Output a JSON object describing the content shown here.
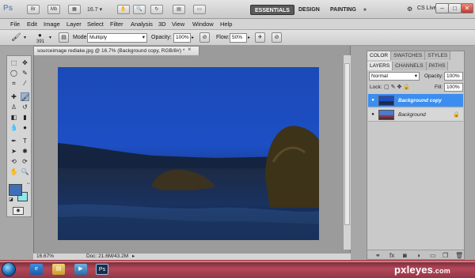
{
  "topbar": {
    "logo": "Ps",
    "icons": [
      "Br",
      "Mb"
    ],
    "zoom": "16.7",
    "workspaces": [
      "ESSENTIALS",
      "DESIGN",
      "PAINTING",
      "»"
    ],
    "cs_live": "CS Live",
    "window_buttons": [
      "–",
      "□",
      "✕"
    ]
  },
  "menubar": {
    "items": [
      "File",
      "Edit",
      "Image",
      "Layer",
      "Select",
      "Filter",
      "Analysis",
      "3D",
      "View",
      "Window",
      "Help"
    ]
  },
  "options": {
    "brush_size": "391",
    "mode_label": "Mode:",
    "mode_value": "Multiply",
    "opacity_label": "Opacity:",
    "opacity_value": "100%",
    "flow_label": "Flow:",
    "flow_value": "50%"
  },
  "document": {
    "tab_title": "sourceimage redlake.jpg @ 16.7% (Background copy, RGB/8#) *",
    "close": "×",
    "status_zoom": "16.67%",
    "status_doc": "Doc: 21.6M/43.2M"
  },
  "panels": {
    "tabs_top": [
      "COLOR",
      "SWATCHES",
      "STYLES"
    ],
    "tabs_layers": [
      "LAYERS",
      "CHANNELS",
      "PATHS"
    ],
    "blend_mode": "Normal",
    "opacity_label": "Opacity:",
    "opacity_value": "100%",
    "lock_label": "Lock:",
    "fill_label": "Fill:",
    "fill_value": "100%",
    "layers": [
      {
        "name": "Background copy",
        "selected": true
      },
      {
        "name": "Background",
        "selected": false
      }
    ]
  },
  "colors": {
    "foreground": "#3f6fb5",
    "background": "#8fe6ec",
    "selected_layer": "#3b8ef0"
  },
  "taskbar": {
    "brand": "pxleyes",
    "brand_suffix": ".com",
    "active_app": "Ps"
  }
}
